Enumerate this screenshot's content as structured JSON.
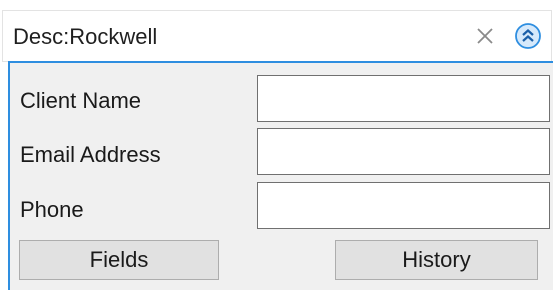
{
  "search": {
    "value": "Desc:Rockwell",
    "clear_icon": "close-icon",
    "collapse_icon": "chevron-double-up-icon"
  },
  "form": {
    "fields": [
      {
        "label": "Client Name",
        "value": ""
      },
      {
        "label": "Email Address",
        "value": ""
      },
      {
        "label": "Phone",
        "value": ""
      }
    ]
  },
  "buttons": {
    "fields_label": "Fields",
    "history_label": "History"
  },
  "colors": {
    "accent": "#2e8ee0",
    "panel_bg": "#f0f0f0",
    "button_bg": "#e1e1e1"
  }
}
